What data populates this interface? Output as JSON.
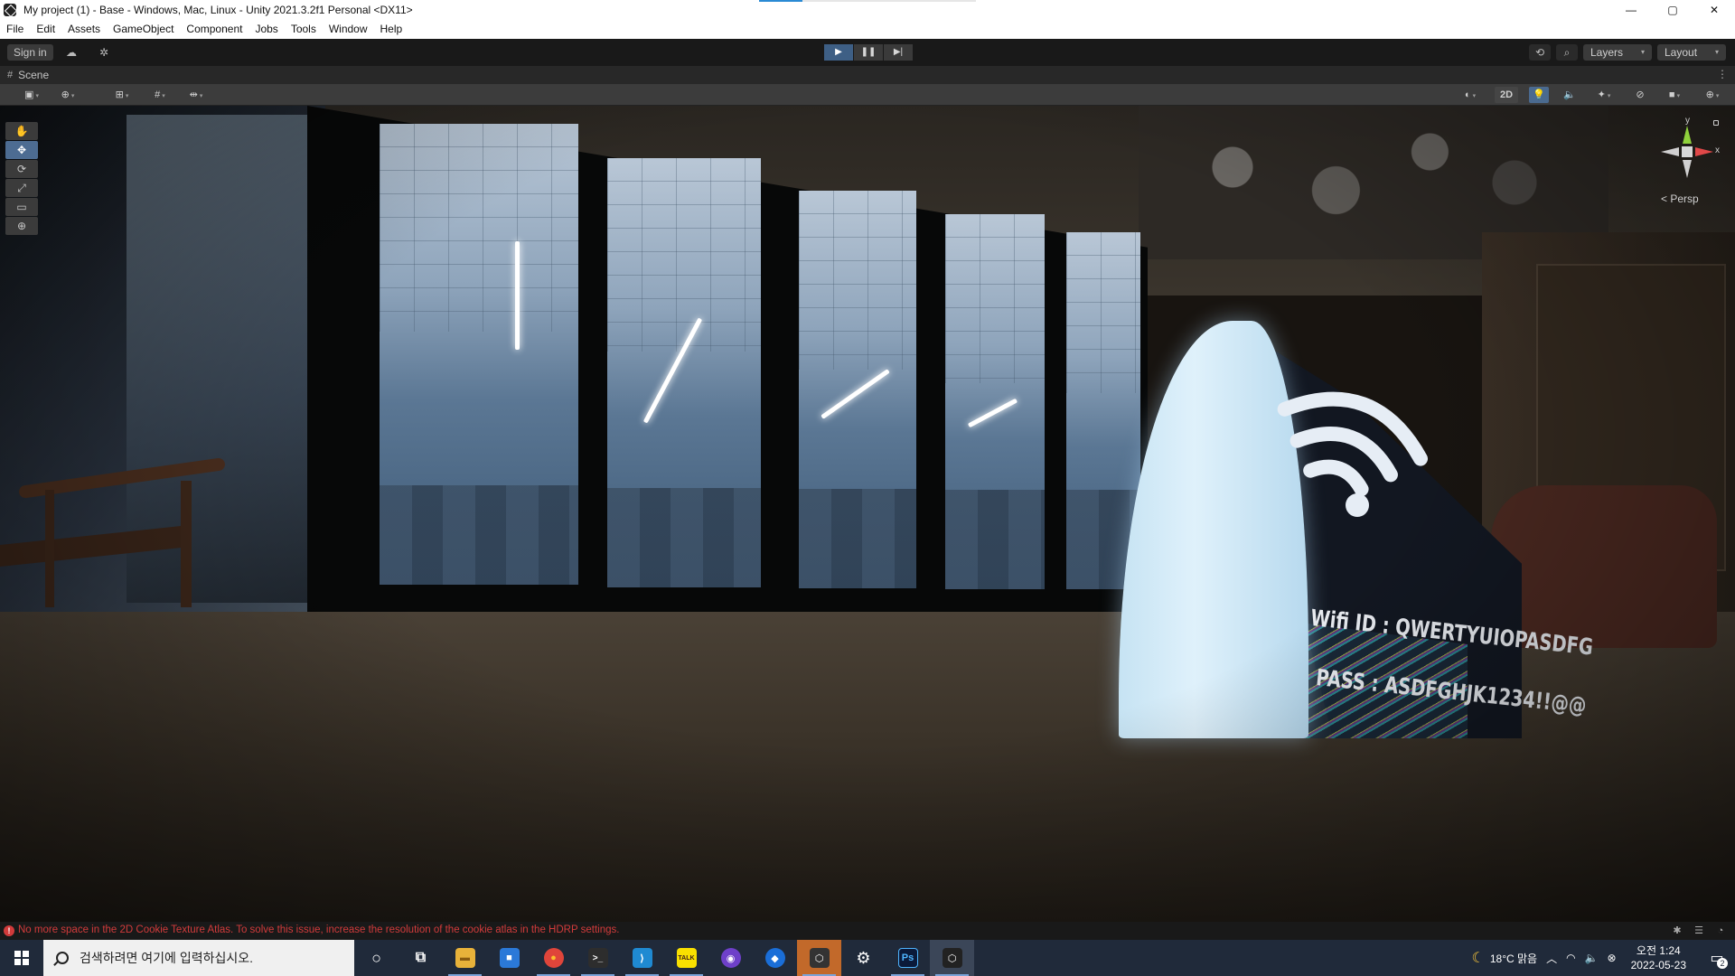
{
  "window": {
    "title": "My project (1) - Base - Windows, Mac, Linux - Unity 2021.3.2f1 Personal <DX11>",
    "controls": [
      "—",
      "▢",
      "✕"
    ]
  },
  "menu": [
    "File",
    "Edit",
    "Assets",
    "GameObject",
    "Component",
    "Jobs",
    "Tools",
    "Window",
    "Help"
  ],
  "toolbar": {
    "sign_in": "Sign in",
    "play_buttons": [
      "▶",
      "❚❚",
      "▶|"
    ],
    "layers_label": "Layers",
    "layout_label": "Layout",
    "dropdown_arrow": "▾"
  },
  "scene": {
    "tab_label": "Scene",
    "kebab": "⋮",
    "mode_2d": "2D",
    "persp_label": "< Persp",
    "gizmo_y": "y",
    "gizmo_x": "x"
  },
  "sign": {
    "wifi_line": "Wifi ID : QWERTYUIOPASDFG",
    "pass_line": "PASS : ASDFGHJK1234!!@@"
  },
  "status": {
    "error_message": "No more space in the 2D Cookie Texture Atlas. To solve this issue, increase the resolution of the cookie atlas in the HDRP settings."
  },
  "taskbar": {
    "search_placeholder": "검색하려면 여기에 입력하십시오.",
    "weather": "18°C 맑음",
    "time": "오전 1:24",
    "date": "2022-05-23",
    "notification_count": "2",
    "apps": [
      {
        "name": "cortana",
        "label": "○"
      },
      {
        "name": "task-view",
        "label": "⧉"
      },
      {
        "name": "file-explorer",
        "label": "▬"
      },
      {
        "name": "store",
        "label": "■"
      },
      {
        "name": "chrome",
        "label": "●"
      },
      {
        "name": "terminal",
        "label": ">_"
      },
      {
        "name": "vscode",
        "label": "⟩"
      },
      {
        "name": "kakaotalk",
        "label": "TALK"
      },
      {
        "name": "github-desktop",
        "label": "◉"
      },
      {
        "name": "sourcetree",
        "label": "◆"
      },
      {
        "name": "unity-hub",
        "label": "⬡"
      },
      {
        "name": "settings",
        "label": "⚙"
      },
      {
        "name": "photoshop",
        "label": "Ps"
      },
      {
        "name": "unity",
        "label": "⬡"
      }
    ]
  },
  "colors": {
    "play_active": "#3e5f85",
    "error_red": "#d23b3b",
    "taskbar_bg": "#202a3a"
  }
}
